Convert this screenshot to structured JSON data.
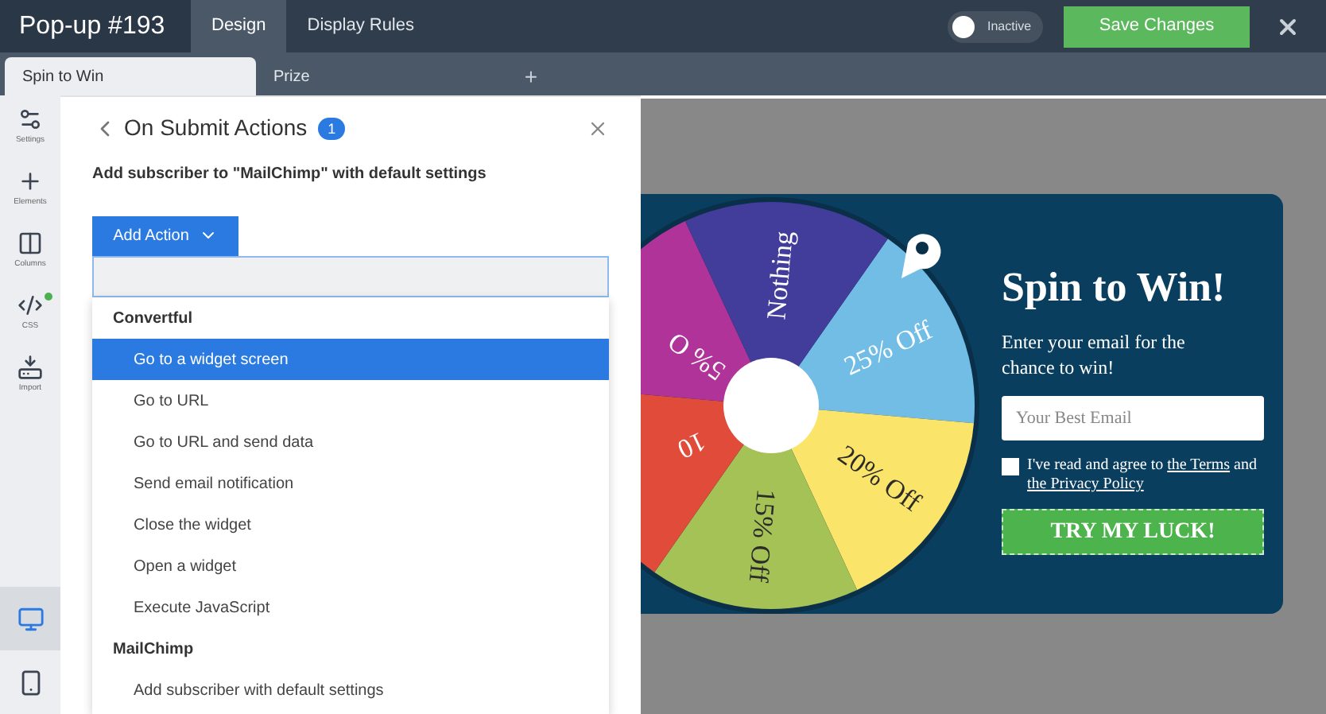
{
  "header": {
    "title": "Pop-up #193",
    "tabs": [
      {
        "label": "Design",
        "selected": true
      },
      {
        "label": "Display Rules",
        "selected": false
      }
    ],
    "toggle": {
      "label": "Inactive",
      "on": false
    },
    "save_button": "Save Changes"
  },
  "screen_tabs": {
    "tabs": [
      {
        "label": "Spin to Win",
        "selected": true
      },
      {
        "label": "Prize",
        "selected": false
      }
    ],
    "add": "+"
  },
  "sidebar": {
    "tools": [
      {
        "kind": "settings",
        "label": "Settings",
        "dot": false
      },
      {
        "kind": "elements",
        "label": "Elements",
        "dot": false
      },
      {
        "kind": "columns",
        "label": "Columns",
        "dot": false
      },
      {
        "kind": "css",
        "label": "CSS",
        "dot": true
      },
      {
        "kind": "import",
        "label": "Import",
        "dot": false
      }
    ],
    "devices": [
      {
        "kind": "desktop",
        "selected": true
      },
      {
        "kind": "mobile",
        "selected": false
      }
    ]
  },
  "panel": {
    "title": "On Submit Actions",
    "count": "1",
    "summary": "Add subscriber to \"MailChimp\" with default settings",
    "add_action": "Add Action",
    "groups": [
      {
        "name": "Convertful",
        "items": [
          {
            "label": "Go to a widget screen",
            "selected": true
          },
          {
            "label": "Go to URL",
            "selected": false
          },
          {
            "label": "Go to URL and send data",
            "selected": false
          },
          {
            "label": "Send email notification",
            "selected": false
          },
          {
            "label": "Close the widget",
            "selected": false
          },
          {
            "label": "Open a widget",
            "selected": false
          },
          {
            "label": "Execute JavaScript",
            "selected": false
          }
        ]
      },
      {
        "name": "MailChimp",
        "items": [
          {
            "label": "Add subscriber with default settings",
            "selected": false
          }
        ]
      }
    ]
  },
  "popup": {
    "wheel": [
      {
        "label": "25% Off",
        "color": "#72bde6"
      },
      {
        "label": "20% Off",
        "color": "#fbe46a"
      },
      {
        "label": "15% Off",
        "color": "#a4c255"
      },
      {
        "label": "10",
        "color": "#e04b3a"
      },
      {
        "label": "5% O",
        "color": "#b0339a"
      },
      {
        "label": "Nothing",
        "color": "#423d9a"
      }
    ],
    "title": "Spin to Win!",
    "text": "Enter your email for the chance to win!",
    "email_placeholder": "Your Best Email",
    "consent": {
      "checked": false,
      "before": "I've read and agree to",
      "terms": "the Terms",
      "middle": "and",
      "privacy": "the Privacy Policy"
    },
    "button": "TRY MY LUCK!"
  }
}
